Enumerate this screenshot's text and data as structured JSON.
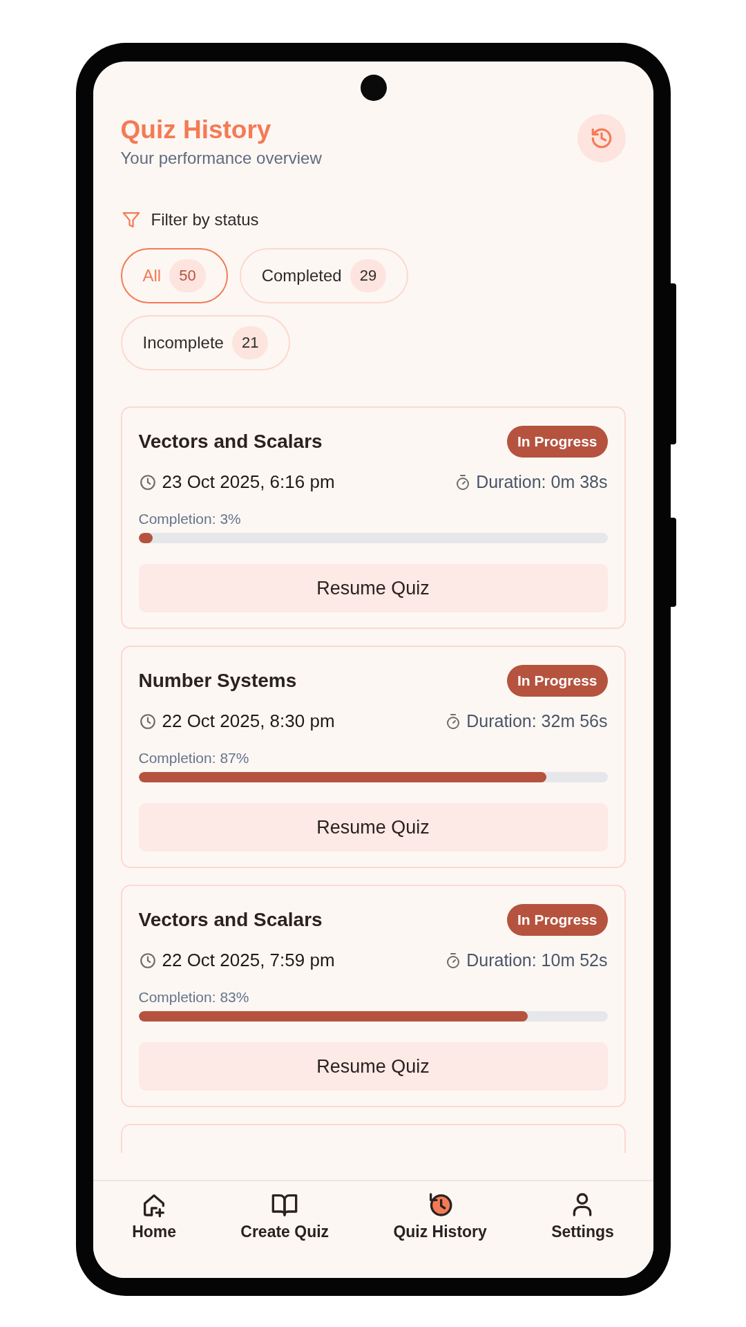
{
  "header": {
    "title": "Quiz History",
    "subtitle": "Your performance overview"
  },
  "filter": {
    "label": "Filter by status",
    "chips": [
      {
        "label": "All",
        "count": "50",
        "selected": true
      },
      {
        "label": "Completed",
        "count": "29",
        "selected": false
      },
      {
        "label": "Incomplete",
        "count": "21",
        "selected": false
      }
    ]
  },
  "quizzes": [
    {
      "title": "Vectors and Scalars",
      "status": "In Progress",
      "date": "23 Oct 2025, 6:16 pm",
      "duration": "Duration: 0m 38s",
      "completion": "Completion: 3%",
      "level": 0.03,
      "action": "Resume Quiz"
    },
    {
      "title": "Number Systems",
      "status": "In Progress",
      "date": "22 Oct 2025, 8:30 pm",
      "duration": "Duration: 32m 56s",
      "completion": "Completion: 87%",
      "level": 0.87,
      "action": "Resume Quiz"
    },
    {
      "title": "Vectors and Scalars",
      "status": "In Progress",
      "date": "22 Oct 2025, 7:59 pm",
      "duration": "Duration: 10m 52s",
      "completion": "Completion: 83%",
      "level": 0.83,
      "action": "Resume Quiz"
    }
  ],
  "nav": [
    {
      "label": "Home",
      "selected": false
    },
    {
      "label": "Create Quiz",
      "selected": false
    },
    {
      "label": "Quiz History",
      "selected": true
    },
    {
      "label": "Settings",
      "selected": false
    }
  ]
}
